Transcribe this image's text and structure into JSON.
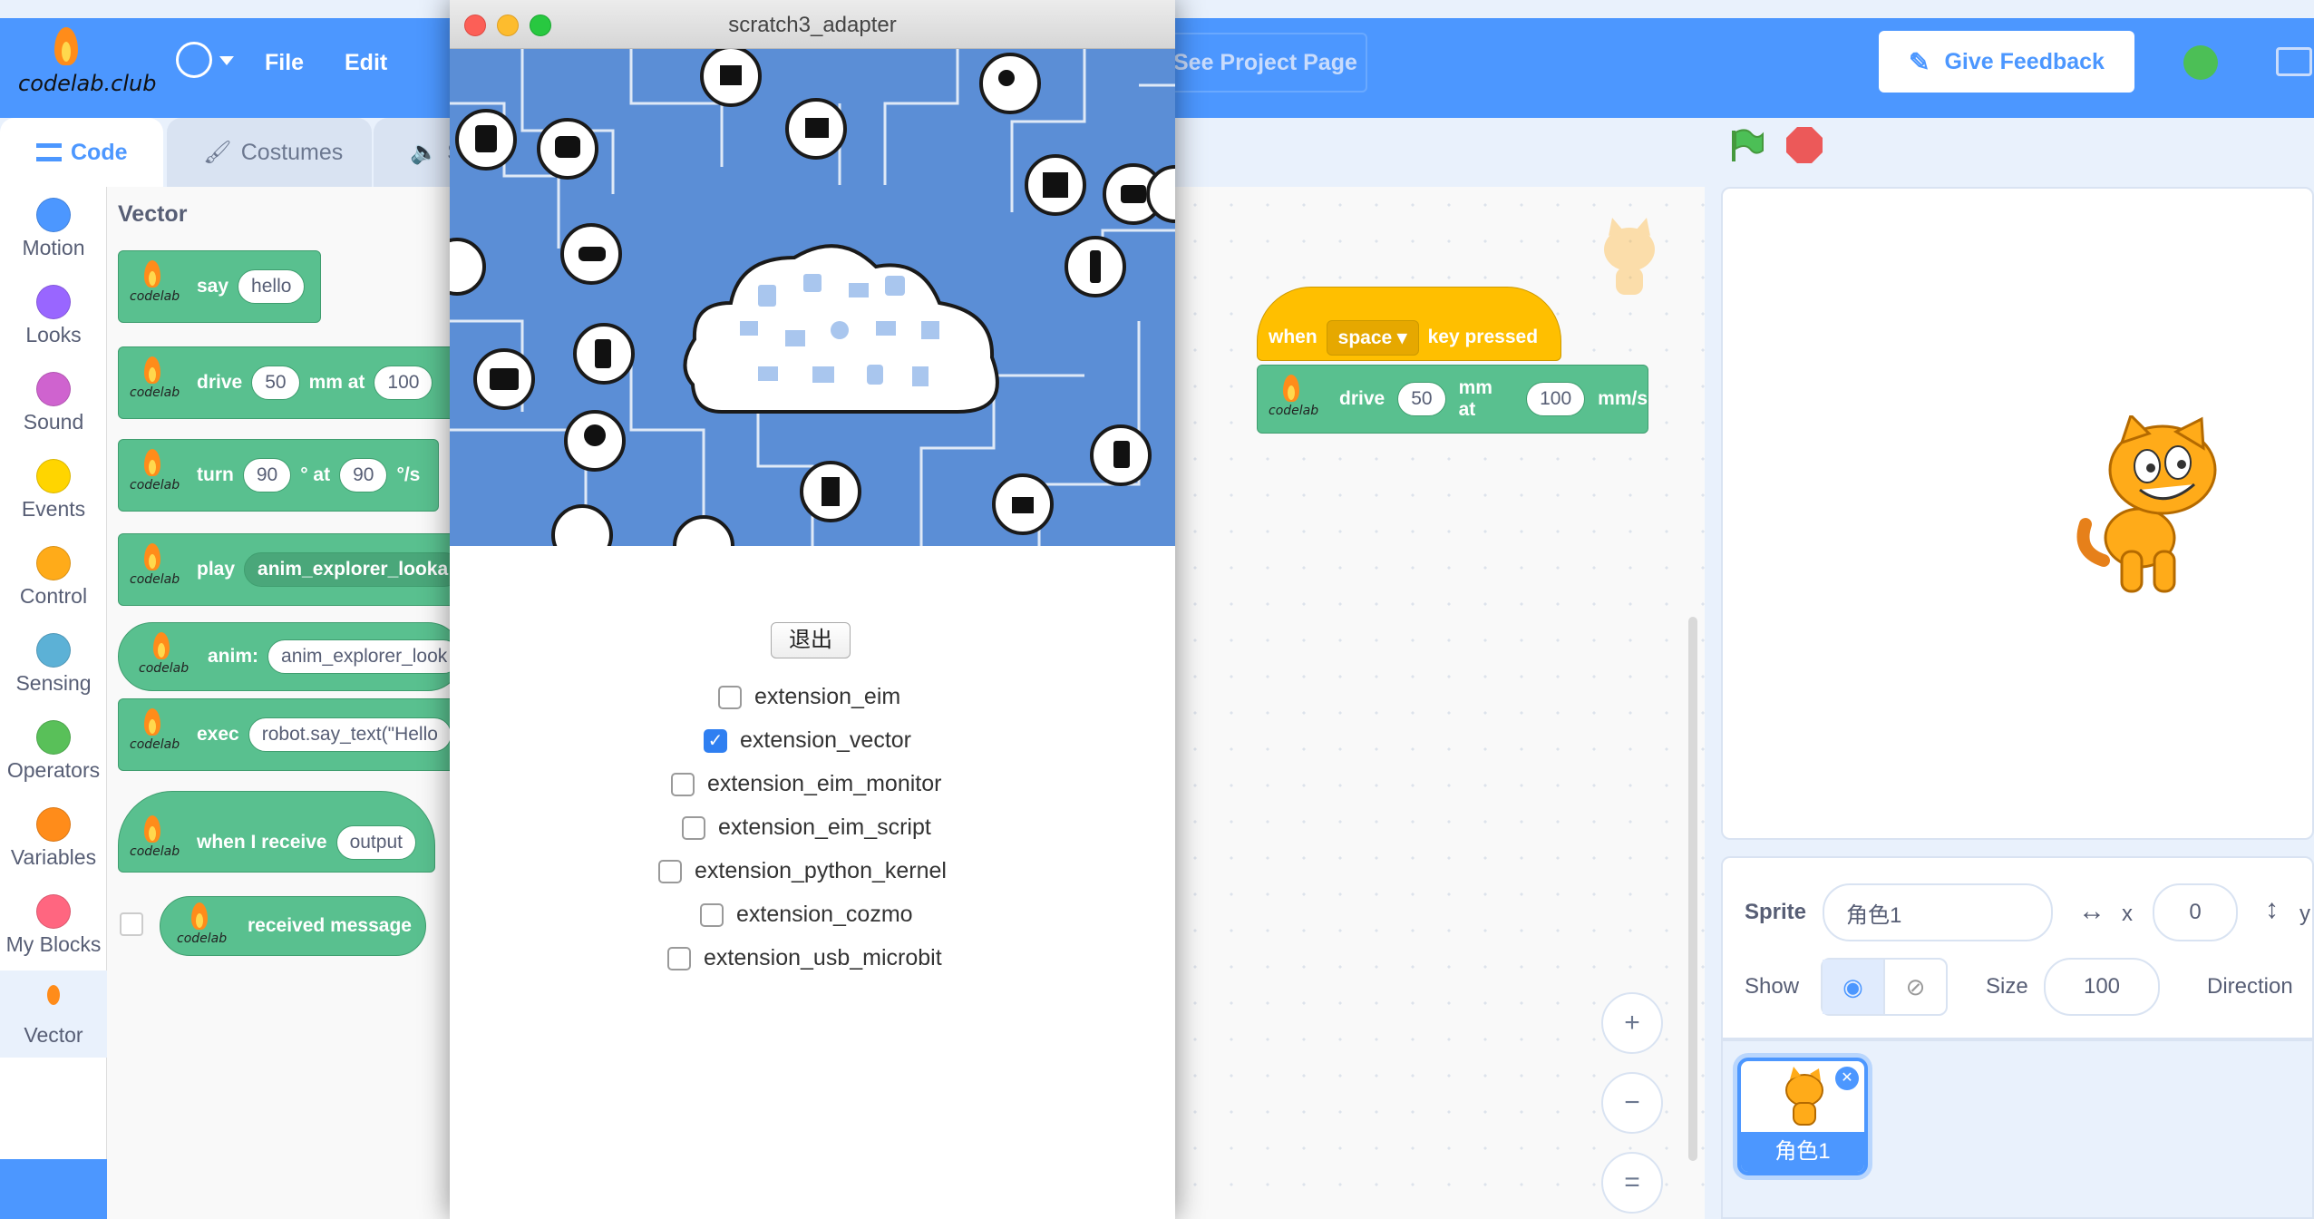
{
  "header": {
    "logo_text": "codelab.club",
    "file": "File",
    "edit": "Edit",
    "project_page": "See Project Page",
    "feedback": "Give Feedback"
  },
  "tabs": {
    "code": "Code",
    "costumes": "Costumes",
    "sounds": "S"
  },
  "categories": [
    {
      "label": "Motion",
      "color": "#4c97ff"
    },
    {
      "label": "Looks",
      "color": "#9966ff"
    },
    {
      "label": "Sound",
      "color": "#cf63cf"
    },
    {
      "label": "Events",
      "color": "#ffd500"
    },
    {
      "label": "Control",
      "color": "#ffab19"
    },
    {
      "label": "Sensing",
      "color": "#5cb1d6"
    },
    {
      "label": "Operators",
      "color": "#59c059"
    },
    {
      "label": "Variables",
      "color": "#ff8c1a"
    },
    {
      "label": "My Blocks",
      "color": "#ff6680"
    },
    {
      "label": "Vector",
      "color": "#ffffff"
    }
  ],
  "palette": {
    "title": "Vector",
    "icon_label": "codelab",
    "say": {
      "label": "say",
      "arg": "hello"
    },
    "drive": {
      "label": "drive",
      "arg1": "50",
      "mid": "mm at",
      "arg2": "100"
    },
    "turn": {
      "label": "turn",
      "arg1": "90",
      "mid": "° at",
      "arg2": "90",
      "unit": "°/s"
    },
    "play": {
      "label": "play",
      "arg": "anim_explorer_looka"
    },
    "anim": {
      "label": "anim:",
      "arg": "anim_explorer_look"
    },
    "exec": {
      "label": "exec",
      "arg": "robot.say_text(\"Hello"
    },
    "receive": {
      "label": "when I receive",
      "arg": "output"
    },
    "received": {
      "label": "received message"
    }
  },
  "dialog": {
    "title": "scratch3_adapter",
    "quit": "退出",
    "options": [
      {
        "label": "extension_eim",
        "checked": false
      },
      {
        "label": "extension_vector",
        "checked": true
      },
      {
        "label": "extension_eim_monitor",
        "checked": false
      },
      {
        "label": "extension_eim_script",
        "checked": false
      },
      {
        "label": "extension_python_kernel",
        "checked": false
      },
      {
        "label": "extension_cozmo",
        "checked": false
      },
      {
        "label": "extension_usb_microbit",
        "checked": false
      }
    ]
  },
  "workspace": {
    "hat": {
      "when": "when",
      "key": "space",
      "pressed": "key pressed"
    },
    "drive": {
      "label": "drive",
      "arg1": "50",
      "mid": "mm at",
      "arg2": "100",
      "unit": "mm/s"
    },
    "icon_label": "codelab"
  },
  "sprite_info": {
    "sprite_label": "Sprite",
    "sprite_name": "角色1",
    "x_label": "x",
    "x_value": "0",
    "y_label": "y",
    "show_label": "Show",
    "size_label": "Size",
    "size_value": "100",
    "direction_label": "Direction"
  },
  "sprite_list": [
    {
      "name": "角色1"
    }
  ],
  "zoom": {
    "in": "+",
    "out": "−",
    "reset": "="
  }
}
